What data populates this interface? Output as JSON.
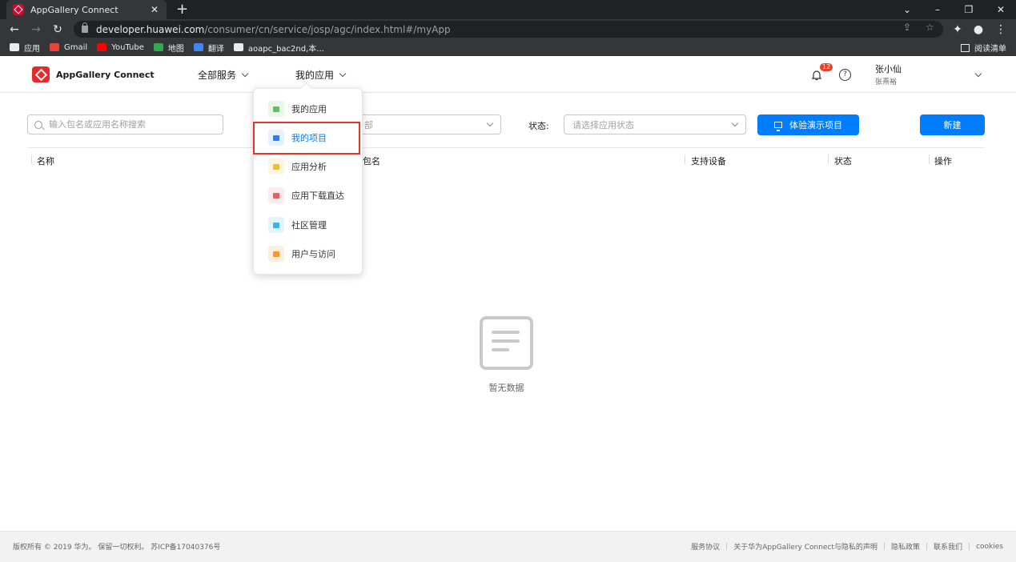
{
  "browser": {
    "tab_title": "AppGallery Connect",
    "new_tab_symbol": "+",
    "url_host": "developer.huawei.com",
    "url_path": "/consumer/cn/service/josp/agc/index.html#/myApp",
    "bookmarks": [
      {
        "label": "应用",
        "color": "#e8eaed"
      },
      {
        "label": "Gmail",
        "color": "#ea4335"
      },
      {
        "label": "YouTube",
        "color": "#ff0000"
      },
      {
        "label": "地图",
        "color": "#34a853"
      },
      {
        "label": "翻译",
        "color": "#4285f4"
      },
      {
        "label": "aoapc_bac2nd,本...",
        "color": "#e8eaed"
      }
    ],
    "reading_list": "阅读清单"
  },
  "header": {
    "logo_text": "AppGallery Connect",
    "nav_all_services": "全部服务",
    "nav_my_apps": "我的应用",
    "notification_count": "12",
    "help_symbol": "?",
    "user_name": "张小仙",
    "user_sub": "张熹裕"
  },
  "filters": {
    "search_placeholder": "输入包名或应用名称搜索",
    "second_select_partial": "部",
    "status_label": "状态:",
    "status_placeholder": "请选择应用状态",
    "demo_button": "体验演示项目",
    "new_button": "新建"
  },
  "table": {
    "headers": [
      "名称",
      "包名",
      "支持设备",
      "状态",
      "操作"
    ],
    "empty_text": "暂无数据"
  },
  "dropdown": {
    "items": [
      {
        "label": "我的应用",
        "icon": "grid-icon",
        "bg": "#e8f7e8",
        "fg": "#5cc15c"
      },
      {
        "label": "我的项目",
        "icon": "folder-icon",
        "bg": "#e6f1ff",
        "fg": "#2f7cf6"
      },
      {
        "label": "应用分析",
        "icon": "chart-icon",
        "bg": "#fdf6df",
        "fg": "#f2be2c"
      },
      {
        "label": "应用下载直达",
        "icon": "download-icon",
        "bg": "#fdeaea",
        "fg": "#f25c5c"
      },
      {
        "label": "社区管理",
        "icon": "community-icon",
        "bg": "#e4f4fb",
        "fg": "#3fb2e6"
      },
      {
        "label": "用户与访问",
        "icon": "user-icon",
        "bg": "#fdefe0",
        "fg": "#f59a2e"
      }
    ],
    "active_item": "我的项目"
  },
  "footer": {
    "copyright": "版权所有 © 2019 华为。 保留一切权利。 苏ICP备17040376号",
    "links": [
      "服务协议",
      "关于华为AppGallery Connect与隐私的声明",
      "隐私政策",
      "联系我们",
      "cookies"
    ]
  },
  "colors": {
    "primary": "#007dff",
    "brand_red": "#e52a2a",
    "highlight": "#e5322d"
  }
}
